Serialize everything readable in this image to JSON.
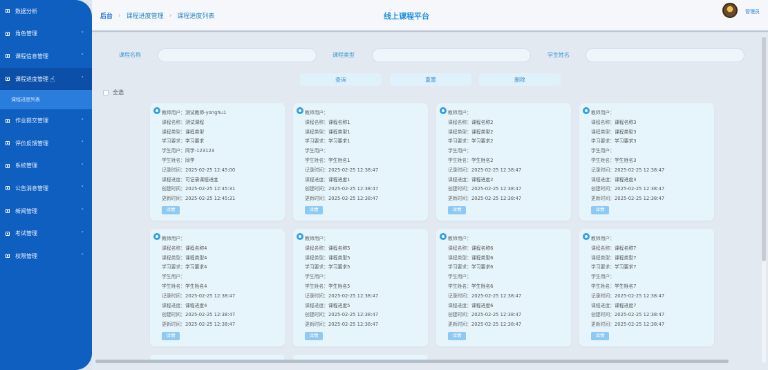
{
  "sidebar": {
    "items": [
      {
        "label": "数据分析",
        "has_arrow": false
      },
      {
        "label": "角色管理",
        "has_arrow": true
      },
      {
        "label": "课程信息管理",
        "has_arrow": true
      },
      {
        "label": "课程进度管理",
        "has_arrow": true,
        "active": true
      },
      {
        "label": "作业提交管理",
        "has_arrow": true
      },
      {
        "label": "评价反馈管理",
        "has_arrow": true
      },
      {
        "label": "系统管理",
        "has_arrow": true
      },
      {
        "label": "公告消息管理",
        "has_arrow": true
      },
      {
        "label": "新闻管理",
        "has_arrow": true
      },
      {
        "label": "考试管理",
        "has_arrow": true
      },
      {
        "label": "权限管理",
        "has_arrow": true
      }
    ],
    "submenu": {
      "label": "课程进度列表"
    }
  },
  "header": {
    "breadcrumb": [
      "后台",
      "课程进度管理",
      "课程进度列表"
    ],
    "title": "线上课程平台",
    "user_name": "管理员"
  },
  "search": {
    "course_name_label": "课程名称",
    "course_type_label": "课程类型",
    "student_name_label": "学生姓名",
    "course_name_value": "",
    "course_type_value": "",
    "student_name_value": ""
  },
  "buttons": {
    "query": "查询",
    "reset": "重置",
    "delete": "删除"
  },
  "select_all": "全选",
  "detail_label": "详情",
  "field_labels": [
    "教师用户：",
    "课程名称：",
    "课程类型：",
    "学习要求：",
    "学生用户：",
    "学生姓名：",
    "记录时间：",
    "课程进度：",
    "创建时间：",
    "更新时间："
  ],
  "cards": [
    {
      "values": [
        "测试教师-yonghu1",
        "测试课程",
        "课程类型",
        "学习要求",
        "同学-123123",
        "同学",
        "2025-02-25 12:45:00",
        "可记录课程进度",
        "2025-02-25 12:45:31",
        "2025-02-25 12:45:31"
      ]
    },
    {
      "values": [
        "",
        "课程名称1",
        "课程类型1",
        "学习要求1",
        "",
        "学生姓名1",
        "2025-02-25 12:38:47",
        "课程进度1",
        "2025-02-25 12:38:47",
        "2025-02-25 12:38:47"
      ]
    },
    {
      "values": [
        "",
        "课程名称2",
        "课程类型2",
        "学习要求2",
        "",
        "学生姓名2",
        "2025-02-25 12:38:47",
        "课程进度2",
        "2025-02-25 12:38:47",
        "2025-02-25 12:38:47"
      ]
    },
    {
      "values": [
        "",
        "课程名称3",
        "课程类型3",
        "学习要求3",
        "",
        "学生姓名3",
        "2025-02-25 12:38:47",
        "课程进度3",
        "2025-02-25 12:38:47",
        "2025-02-25 12:38:47"
      ]
    },
    {
      "values": [
        "",
        "课程名称4",
        "课程类型4",
        "学习要求4",
        "",
        "学生姓名4",
        "2025-02-25 12:38:47",
        "课程进度4",
        "2025-02-25 12:38:47",
        "2025-02-25 12:38:47"
      ]
    },
    {
      "values": [
        "",
        "课程名称5",
        "课程类型5",
        "学习要求5",
        "",
        "学生姓名5",
        "2025-02-25 12:38:47",
        "课程进度5",
        "2025-02-25 12:38:47",
        "2025-02-25 12:38:47"
      ]
    },
    {
      "values": [
        "",
        "课程名称6",
        "课程类型6",
        "学习要求6",
        "",
        "学生姓名6",
        "2025-02-25 12:38:47",
        "课程进度6",
        "2025-02-25 12:38:47",
        "2025-02-25 12:38:47"
      ]
    },
    {
      "values": [
        "",
        "课程名称7",
        "课程类型7",
        "学习要求7",
        "",
        "学生姓名7",
        "2025-02-25 12:38:47",
        "课程进度7",
        "2025-02-25 12:38:47",
        "2025-02-25 12:38:47"
      ]
    }
  ],
  "colors": {
    "sidebar": "#0f5fc0",
    "accent": "#1a8fd8",
    "card_bg": "#e6f5fc"
  }
}
